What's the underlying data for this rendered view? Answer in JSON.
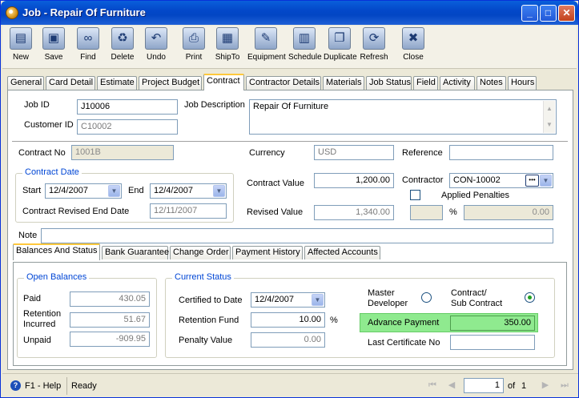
{
  "window": {
    "title": "Job - Repair Of Furniture"
  },
  "toolbar": {
    "items": [
      {
        "label": "New",
        "icon": "new-document-icon"
      },
      {
        "label": "Save",
        "icon": "floppy-disk-icon"
      },
      {
        "label": "Find",
        "icon": "binoculars-icon"
      },
      {
        "label": "Delete",
        "icon": "recycle-bin-icon"
      },
      {
        "label": "Undo",
        "icon": "undo-arrow-icon"
      },
      {
        "label": "Print",
        "icon": "printer-icon"
      },
      {
        "label": "ShipTo",
        "icon": "hand-truck-icon"
      },
      {
        "label": "Equipment",
        "icon": "wrench-icon"
      },
      {
        "label": "Schedule",
        "icon": "calendar-gear-icon"
      },
      {
        "label": "Duplicate",
        "icon": "duplicate-pages-icon"
      },
      {
        "label": "Refresh",
        "icon": "refresh-icon"
      },
      {
        "label": "Close",
        "icon": "close-window-icon"
      }
    ]
  },
  "tabs": [
    "General",
    "Card Detail",
    "Estimate",
    "Project Budget",
    "Contract",
    "Contractor Details",
    "Materials",
    "Job Status",
    "Field",
    "Activity",
    "Notes",
    "Hours"
  ],
  "active_tab": "Contract",
  "header": {
    "job_id_label": "Job ID",
    "job_id": "J10006",
    "customer_id_label": "Customer ID",
    "customer_id": "C10002",
    "job_description_label": "Job Description",
    "job_description": "Repair Of Furniture"
  },
  "contract": {
    "contract_no_label": "Contract No",
    "contract_no": "1001B",
    "currency_label": "Currency",
    "currency": "USD",
    "reference_label": "Reference",
    "reference": "",
    "contract_date_title": "Contract Date",
    "start_label": "Start",
    "start": "12/4/2007",
    "end_label": "End",
    "end": "12/4/2007",
    "revised_end_label": "Contract Revised End Date",
    "revised_end": "12/11/2007",
    "contract_value_label": "Contract Value",
    "contract_value": "1,200.00",
    "revised_value_label": "Revised Value",
    "revised_value": "1,340.00",
    "contractor_label": "Contractor",
    "contractor": "CON-10002",
    "applied_penalties_label": "Applied Penalties",
    "penalty_pct_label": "%",
    "penalty_value": "0.00",
    "note_label": "Note",
    "note": ""
  },
  "subtabs": [
    "Balances And Status",
    "Bank Guarantee",
    "Change Order",
    "Payment History",
    "Affected Accounts"
  ],
  "active_subtab": "Balances And Status",
  "balances": {
    "title": "Open Balances",
    "paid_label": "Paid",
    "paid": "430.05",
    "retention_label_1": "Retention",
    "retention_label_2": "Incurred",
    "retention": "51.67",
    "unpaid_label": "Unpaid",
    "unpaid": "-909.95"
  },
  "status": {
    "title": "Current Status",
    "certified_label": "Certified to Date",
    "certified": "12/4/2007",
    "retention_fund_label": "Retention Fund",
    "retention_fund": "10.00",
    "retention_pct": "%",
    "penalty_value_label": "Penalty Value",
    "penalty_value": "0.00",
    "master_dev_label_1": "Master",
    "master_dev_label_2": "Developer",
    "contract_sub_label_1": "Contract/",
    "contract_sub_label_2": "Sub Contract",
    "advance_payment_label": "Advance Payment",
    "advance_payment": "350.00",
    "last_cert_label": "Last Certificate No",
    "last_cert": ""
  },
  "statusbar": {
    "help": "F1 - Help",
    "status": "Ready",
    "page": "1",
    "of_label": "of",
    "total": "1"
  }
}
